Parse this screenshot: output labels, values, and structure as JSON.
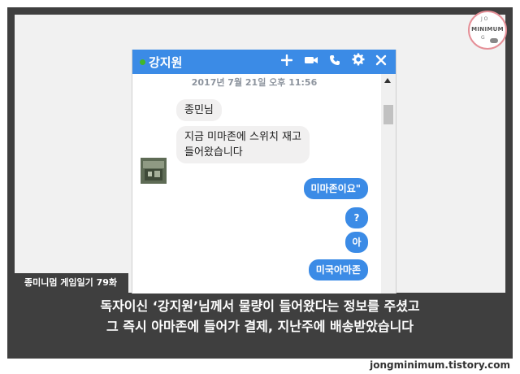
{
  "logo": {
    "text": "MINIMUM",
    "top_letters": "J O",
    "side_letter": "G"
  },
  "chat": {
    "contact_name": "강지원",
    "status_color": "#42b72a",
    "header_icons": [
      "add-icon",
      "video-call-icon",
      "phone-icon",
      "gear-icon",
      "close-icon"
    ],
    "timestamp": "2017년 7월 21일 오후 11:56",
    "incoming": [
      {
        "text": "종민님"
      },
      {
        "line1": "지금 미마존에 스위치 재고",
        "line2": "들어왔습니다"
      }
    ],
    "outgoing": [
      "미마존이요\"",
      "?",
      "아",
      "미국아마존"
    ]
  },
  "series_tag": "종미니멈 게임일기 79화",
  "caption": {
    "line1": "독자이신 ‘강지원’님께서 물량이 들어왔다는 정보를 주셨고",
    "line2": "그 즉시 아마존에 들어가 결제, 지난주에 배송받았습니다"
  },
  "footer_url": "jongminimum.tistory.com",
  "colors": {
    "accent": "#3b8be6",
    "frame": "#3f3f3f",
    "panel": "#f1f1f1",
    "bubble_in": "#f1f0f0"
  }
}
